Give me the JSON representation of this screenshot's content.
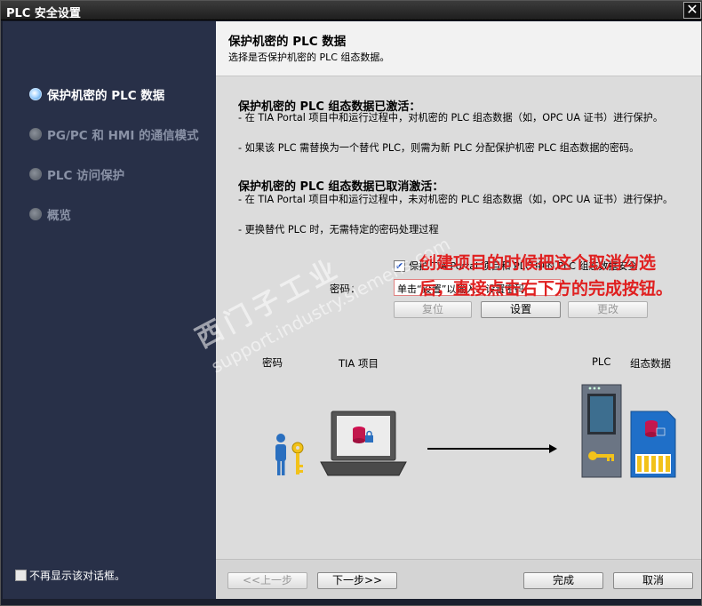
{
  "window": {
    "title": "PLC 安全设置",
    "close_glyph": "✕"
  },
  "sidebar": {
    "items": [
      {
        "label": "保护机密的 PLC 数据",
        "state": "active"
      },
      {
        "label": "PG/PC 和 HMI 的通信模式",
        "state": "inactive"
      },
      {
        "label": "PLC 访问保护",
        "state": "inactive"
      },
      {
        "label": "概览",
        "state": "inactive"
      }
    ],
    "dont_show_label": "不再显示该对话框。"
  },
  "header": {
    "title": "保护机密的 PLC 数据",
    "subtitle": "选择是否保护机密的 PLC 组态数据。"
  },
  "activated": {
    "title": "保护机密的 PLC 组态数据已激活：",
    "line1": "- 在 TIA Portal 项目中和运行过程中，对机密的 PLC 组态数据（如，OPC UA 证书）进行保护。",
    "line2": "- 如果该 PLC 需替换为一个替代 PLC，则需为新 PLC 分配保护机密 PLC 组态数据的密码。"
  },
  "deactivated": {
    "title": "保护机密的 PLC 组态数据已取消激活：",
    "line1": "- 在 TIA Portal 项目中和运行过程中，未对机密的 PLC 组态数据（如，OPC UA 证书）进行保护。",
    "line2": "- 更换替代 PLC 时，无需特定的密码处理过程"
  },
  "protect_checkbox": {
    "label": "保护 TIA Portal 项目和 PLC 中的 PLC 组态数据安全",
    "checked": true
  },
  "password": {
    "label": "密码：",
    "value": "单击“设置”以输入、设置密码",
    "reset_label": "复位",
    "set_label": "设置",
    "change_label": "更改"
  },
  "annotation": {
    "text": "创建项目的时候把这个取消勾选后，直接点击右下方的完成按钮。",
    "color": "#e02020"
  },
  "illustration": {
    "password_label": "密码",
    "tia_label": "TIA 项目",
    "plc_label": "PLC",
    "config_label": "组态数据"
  },
  "watermark": {
    "line1": "西门子工业",
    "line2": "support.industry.siemens.com"
  },
  "footer": {
    "prev_label": "<<上一步",
    "next_label": "下一步>>",
    "finish_label": "完成",
    "cancel_label": "取消"
  },
  "colors": {
    "sidebar_bg": "#283048",
    "content_bg": "#dcdcdc",
    "accent": "#3c8fd8"
  }
}
